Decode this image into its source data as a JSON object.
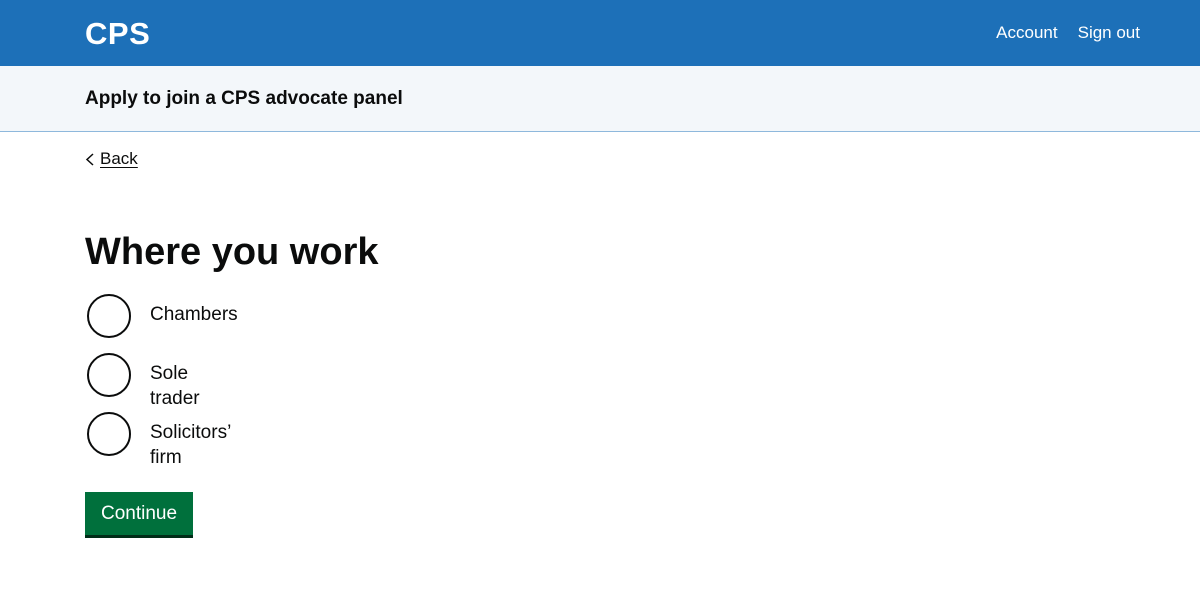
{
  "header": {
    "logo": "CPS",
    "nav": {
      "account": "Account",
      "sign_out": "Sign out"
    },
    "color": "#1d70b8"
  },
  "service": {
    "name": "Apply to join a CPS advocate panel"
  },
  "back": {
    "label": "Back",
    "icon": "chevron-left-icon"
  },
  "main": {
    "title": "Where you work",
    "options": [
      {
        "label": "Chambers",
        "selected": false
      },
      {
        "label": "Sole trader",
        "selected": false
      },
      {
        "label": "Solicitors’ firm",
        "selected": false
      }
    ],
    "continue_label": "Continue",
    "continue_color": "#00703c"
  }
}
